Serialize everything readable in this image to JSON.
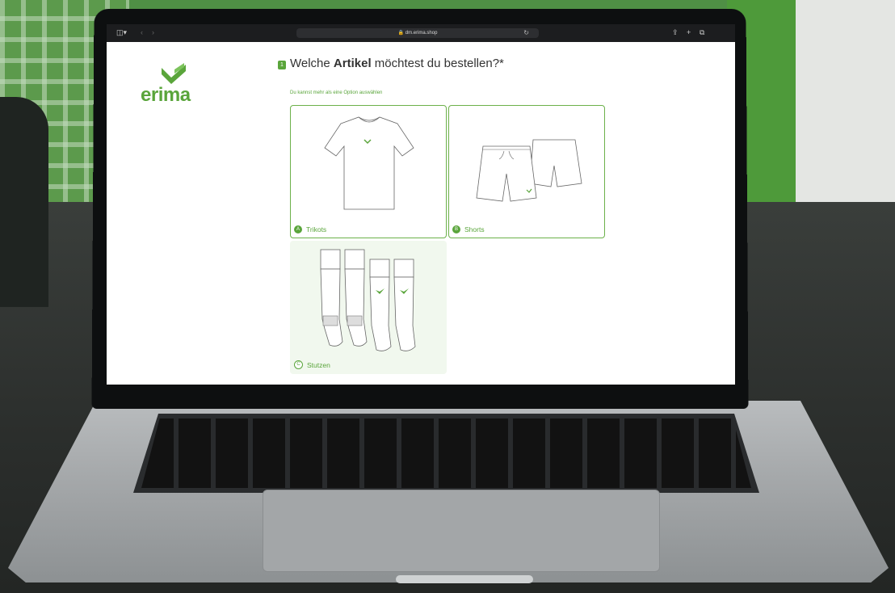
{
  "browser": {
    "url": "dm.erima.shop",
    "icons": [
      "sidebar-icon",
      "back-icon",
      "forward-icon",
      "lock-icon",
      "reload-icon",
      "share-icon",
      "new-tab-icon",
      "tabs-icon"
    ]
  },
  "brand": {
    "name": "erima",
    "color": "#5aa53b"
  },
  "question": {
    "number": "1",
    "text_before": "Welche ",
    "text_bold": "Artikel",
    "text_after": " möchtest du bestellen?*",
    "hint": "Du kannst mehr als eine Option auswählen"
  },
  "options": [
    {
      "key": "A",
      "label": "Trikots",
      "selected": true
    },
    {
      "key": "B",
      "label": "Shorts",
      "selected": true
    },
    {
      "key": "C",
      "label": "Stutzen",
      "selected": false
    }
  ]
}
